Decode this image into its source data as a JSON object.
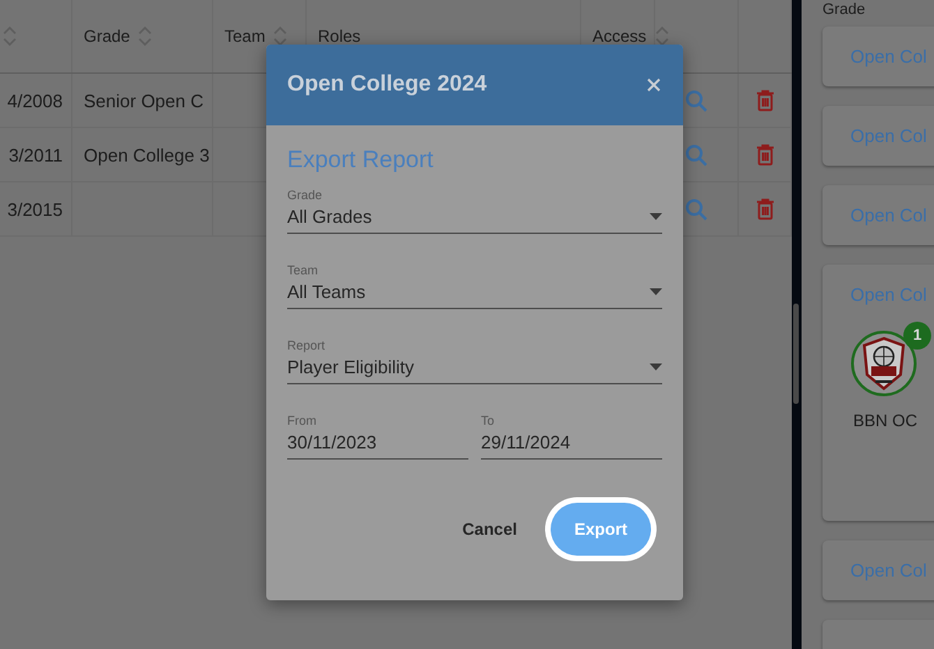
{
  "table": {
    "columns": [
      {
        "sortable": true
      },
      {
        "label": "Grade",
        "sortable": true
      },
      {
        "label": "Team",
        "sortable": true
      },
      {
        "label": "Roles",
        "sortable": false
      },
      {
        "label": "Access",
        "sortable": true
      }
    ],
    "rows": [
      {
        "column_1": "4/2008",
        "grade": "Senior Open C"
      },
      {
        "column_1": "3/2011",
        "grade": "Open College 3"
      },
      {
        "column_1": "3/2015"
      }
    ]
  },
  "side_panel": {
    "heading": "Grade",
    "cards": [
      {
        "kind": "link",
        "label": "Open Col"
      },
      {
        "kind": "link",
        "label": "Open Col"
      },
      {
        "kind": "link",
        "label": "Open Col"
      },
      {
        "kind": "team",
        "label": "Open Col",
        "team_name": "BBN OC",
        "badge": "1"
      },
      {
        "kind": "link",
        "label": "Open Col"
      },
      {
        "kind": "link"
      }
    ]
  },
  "dialog": {
    "title": "Open College 2024",
    "heading": "Export Report",
    "selects": [
      {
        "label": "Grade",
        "value": "All Grades"
      },
      {
        "label": "Team",
        "value": "All Teams"
      },
      {
        "label": "Report",
        "value": "Player Eligibility"
      }
    ],
    "dates": [
      {
        "label": "From",
        "value": "30/11/2023"
      },
      {
        "label": "To",
        "value": "29/11/2024"
      }
    ],
    "buttons": [
      {
        "kind": "text",
        "label": "Cancel",
        "highlighted": false
      },
      {
        "kind": "primary",
        "label": "Export",
        "highlighted": true
      }
    ]
  }
}
